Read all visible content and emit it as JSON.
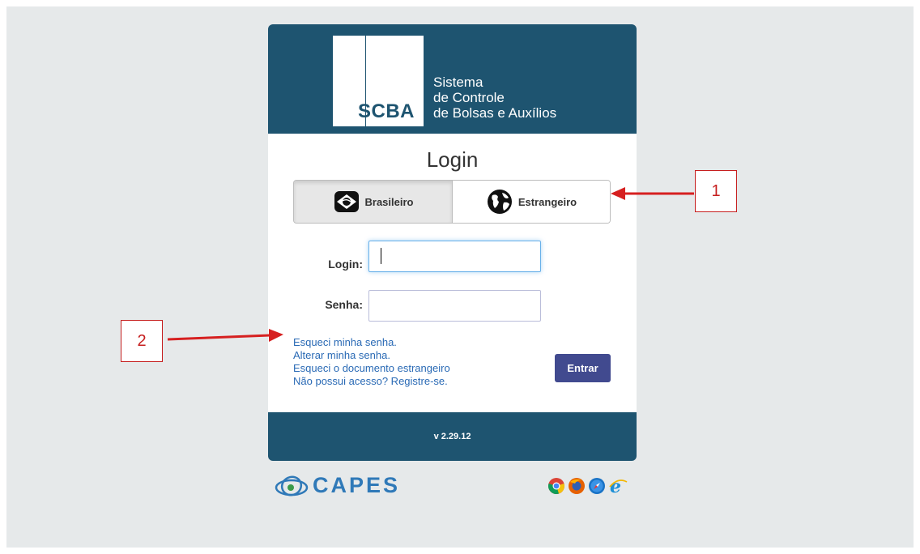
{
  "header": {
    "logo_text": "SCBA",
    "app_name_lines": [
      "Sistema",
      "de Controle",
      "de Bolsas e Auxílios"
    ]
  },
  "login": {
    "title": "Login",
    "toggle": {
      "brasileiro_label": "Brasileiro",
      "estrangeiro_label": "Estrangeiro",
      "selected": "Brasileiro"
    },
    "fields": {
      "login_label": "Login:",
      "login_value": "",
      "senha_label": "Senha:",
      "senha_value": ""
    },
    "links": [
      "Esqueci minha senha.",
      "Alterar minha senha.",
      "Esqueci o documento estrangeiro",
      "Não possui acesso? Registre-se."
    ],
    "submit_label": "Entrar"
  },
  "footer": {
    "version": "v 2.29.12"
  },
  "capes_logo_text": "CAPES",
  "browser_icons": [
    "chrome-icon",
    "firefox-icon",
    "safari-icon",
    "ie-icon"
  ],
  "annotations": [
    "1",
    "2"
  ],
  "colors": {
    "header_bg": "#1e5470",
    "button_bg": "#414a8f",
    "link": "#2a6ab5",
    "annotation": "#c61f1f",
    "page_bg": "#e6e9ea"
  }
}
